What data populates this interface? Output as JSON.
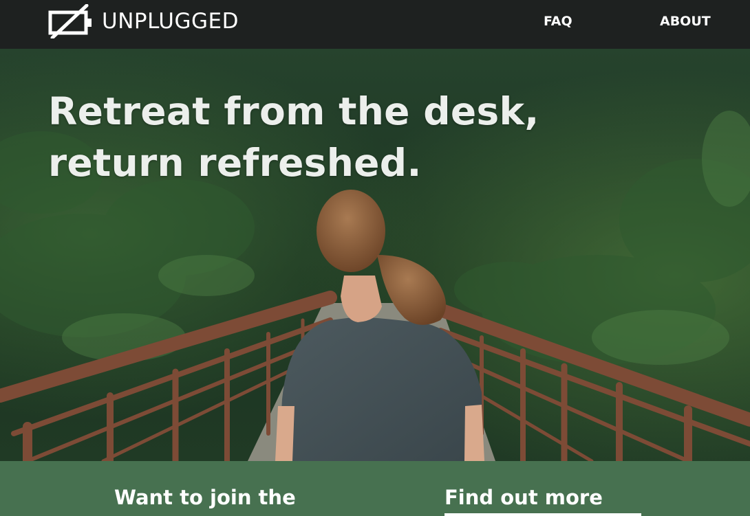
{
  "header": {
    "brand": "UNPLUGGED",
    "logo_icon": "battery-crossed-icon",
    "nav": [
      {
        "label": "FAQ"
      },
      {
        "label": "ABOUT"
      }
    ]
  },
  "hero": {
    "title_line_1": "Retreat from the desk,",
    "title_line_2": "return refreshed."
  },
  "band": {
    "join_heading": "Want to join the",
    "find_heading": "Find out more"
  },
  "colors": {
    "header_bg": "#1e2120",
    "band_bg": "#477150",
    "text": "#ffffff"
  }
}
